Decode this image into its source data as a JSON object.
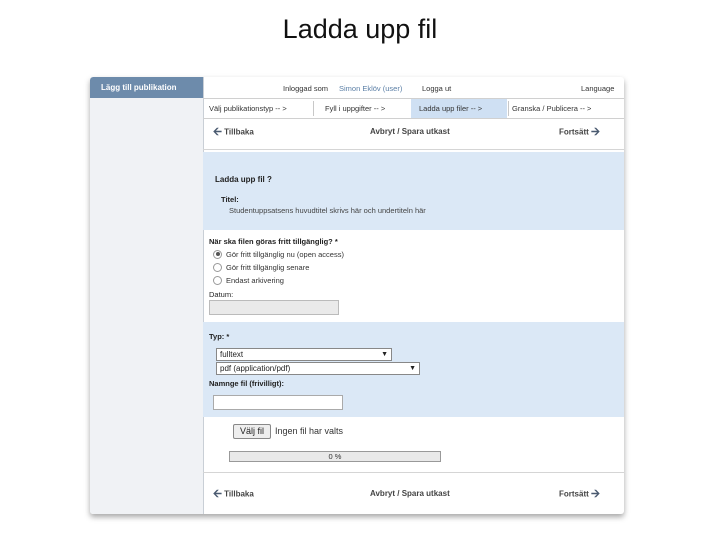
{
  "slide": {
    "title": "Ladda upp fil"
  },
  "sidebar": {
    "header": "Lägg till publikation"
  },
  "topbar": {
    "logged_in_label": "Inloggad som",
    "user": "Simon Eklöv (user)",
    "logout": "Logga ut",
    "language": "Language"
  },
  "steps": [
    {
      "label": "Välj publikationstyp -- >",
      "active": false
    },
    {
      "label": "Fyll i uppgifter -- >",
      "active": false
    },
    {
      "label": "Ladda upp filer -- >",
      "active": true
    },
    {
      "label": "Granska / Publicera -- >",
      "active": false
    }
  ],
  "nav": {
    "back": "Tillbaka",
    "cancel_save": "Avbryt / Spara utkast",
    "continue": "Fortsätt"
  },
  "upload": {
    "heading": "Ladda upp fil ?",
    "title_label": "Titel:",
    "title_value": "Studentuppsatsens huvudtitel skrivs här och undertiteln här"
  },
  "availability": {
    "question": "När ska filen göras fritt tillgänglig? *",
    "options": [
      {
        "label": "Gör fritt tillgänglig nu (open access)",
        "selected": true
      },
      {
        "label": "Gör fritt tillgänglig senare",
        "selected": false
      },
      {
        "label": "Endast arkivering",
        "selected": false
      }
    ],
    "date_label": "Datum:"
  },
  "filetype": {
    "type_label": "Typ: *",
    "type_value": "fulltext",
    "format_value": "pdf (application/pdf)",
    "name_label": "Namnge fil (frivilligt):"
  },
  "file": {
    "button": "Välj fil",
    "status": "Ingen fil har valts",
    "progress_percent": 0,
    "progress_text": "0 %"
  },
  "icons": {
    "back": "arrow-left-icon",
    "forward": "arrow-right-icon"
  }
}
